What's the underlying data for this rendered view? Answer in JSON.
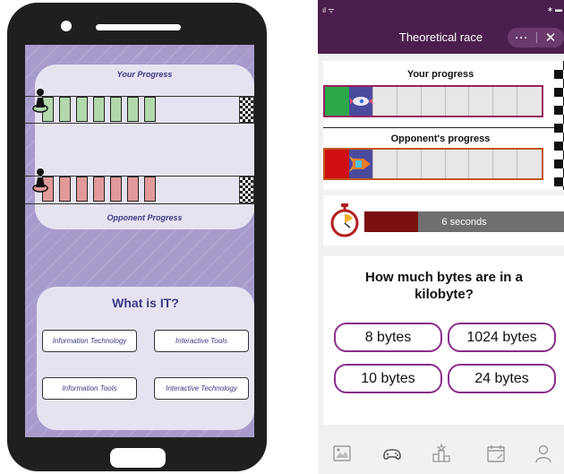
{
  "mockup": {
    "progress_card": {
      "your_label": "Your Progress",
      "opponent_label": "Opponent Progress",
      "your_cells": 7,
      "opponent_cells": 7
    },
    "question_card": {
      "question": "What is IT?",
      "options": [
        "Information Technology",
        "Interactive Tools",
        "Information Tools",
        "Interactive Technology"
      ]
    },
    "colors": {
      "track_green": "#b4d8ad",
      "track_red": "#e19a99",
      "card_bg": "#e6e3f1",
      "screen_bg": "#a79bcc",
      "title_text": "#3b3a86"
    }
  },
  "app": {
    "status_left": "ıl ᯤ",
    "status_right": "∗ ▬",
    "title": "Theoretical race",
    "menu_label": "···",
    "close_label": "✕",
    "your_progress_label": "Your progress",
    "opponent_progress_label": "Opponent's progress",
    "timer_text": "6 seconds",
    "timer_fraction": 0.27,
    "question": "How much bytes are in a kilobyte?",
    "options": [
      "8 bytes",
      "1024 bytes",
      "10 bytes",
      "24 bytes"
    ],
    "nav_icons": [
      "courses-icon",
      "games-icon",
      "ranking-icon",
      "calendar-icon",
      "profile-icon"
    ],
    "colors": {
      "header": "#4b1f4d",
      "accent": "#8a2c8c",
      "your_start": "#2ca84a",
      "opponent_start": "#d01010",
      "timer_fill": "#7a1010",
      "timer_bg": "#6f6f6f"
    }
  }
}
